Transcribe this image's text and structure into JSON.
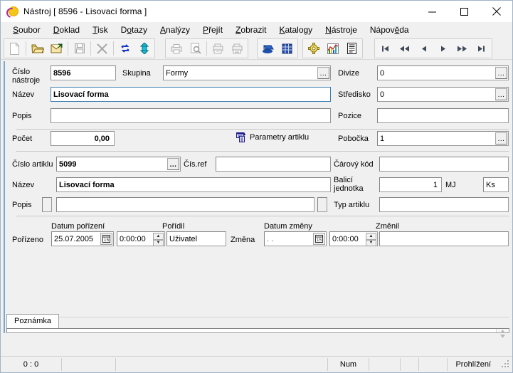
{
  "window": {
    "title": "Nástroj [ 8596 - Lisovací forma ]",
    "icon": "app-logo-icon",
    "minimize": "minimize-icon",
    "maximize": "maximize-icon",
    "close": "close-icon"
  },
  "menu": {
    "items": [
      {
        "label": "Soubor",
        "accel": "S"
      },
      {
        "label": "Doklad",
        "accel": "D"
      },
      {
        "label": "Tisk",
        "accel": "T"
      },
      {
        "label": "Dotazy",
        "accel": "o"
      },
      {
        "label": "Analýzy",
        "accel": "A"
      },
      {
        "label": "Přejít",
        "accel": "P"
      },
      {
        "label": "Zobrazit",
        "accel": "Z"
      },
      {
        "label": "Katalogy",
        "accel": "K"
      },
      {
        "label": "Nástroje",
        "accel": "N"
      },
      {
        "label": "Nápověda",
        "accel": "ě"
      }
    ]
  },
  "toolbar": {
    "groups": [
      {
        "buttons": [
          "new-document-icon",
          "open-folder-icon",
          "save-as-icon",
          "save-disk-icon",
          "delete-cross-icon",
          "refresh-icon",
          "expand-updown-icon"
        ]
      },
      {
        "buttons": [
          "print-icon",
          "print-preview-icon",
          "print-multi-icon",
          "print-batch-icon"
        ]
      },
      {
        "buttons": [
          "archive-box-icon",
          "grid-table-icon"
        ]
      },
      {
        "buttons": [
          "settings-gear-icon",
          "chart-icon",
          "list-report-icon"
        ]
      },
      {
        "buttons": [
          "nav-first-icon",
          "nav-prev-page-icon",
          "nav-prev-icon",
          "nav-next-icon",
          "nav-next-page-icon",
          "nav-last-icon"
        ]
      }
    ]
  },
  "form": {
    "tool_number": {
      "label_line1": "Číslo",
      "label_line2": "nástroje",
      "value": "8596"
    },
    "group": {
      "label": "Skupina",
      "value": "Formy",
      "button": "..."
    },
    "division": {
      "label": "Divize",
      "value": "0",
      "button": "..."
    },
    "name_tool": {
      "label": "Název",
      "value": "Lisovací forma"
    },
    "center": {
      "label": "Středisko",
      "value": "0",
      "button": "..."
    },
    "description_tool": {
      "label": "Popis",
      "value": ""
    },
    "position": {
      "label": "Pozice",
      "value": ""
    },
    "count": {
      "label": "Počet",
      "value": "0,00"
    },
    "parameters_link": {
      "label": "Parametry artiklu",
      "icon": "parameters-icon"
    },
    "branch": {
      "label": "Pobočka",
      "value": "1",
      "button": "..."
    },
    "article_number": {
      "label": "Číslo artiklu",
      "value": "5099",
      "button": "..."
    },
    "ref_number": {
      "label": "Čís.ref",
      "value": ""
    },
    "barcode": {
      "label": "Čárový kód",
      "value": ""
    },
    "article_name": {
      "label": "Název",
      "value": "Lisovací forma"
    },
    "pack_unit": {
      "label_line1": "Balicí",
      "label_line2": "jednotka",
      "value": "1",
      "unit_label": "MJ",
      "unit_value": "Ks"
    },
    "article_description": {
      "label": "Popis",
      "value": ""
    },
    "article_type": {
      "label": "Typ artiklu",
      "value": ""
    },
    "created": {
      "row_label": "Pořízeno",
      "date_label": "Datum pořízení",
      "date_value": "25.07.2005",
      "time_value": "0:00:00",
      "by_label": "Pořídil",
      "by_value": "Uživatel"
    },
    "changed": {
      "row_label": "Změna",
      "date_label": "Datum změny",
      "date_value": ". .",
      "time_value": "0:00:00",
      "by_label": "Změnil",
      "by_value": ""
    }
  },
  "notes": {
    "tab_label": "Poznámka",
    "text": ""
  },
  "statusbar": {
    "record_counter": "0 :   0",
    "cell2": "",
    "cell3": "",
    "num_lock": "Num",
    "cell5": "",
    "cell6": "",
    "cell7": "",
    "mode": "Prohlížení"
  },
  "colors": {
    "window_bg": "#f0f0f0",
    "field_bg": "#ffffff",
    "focus_border": "#3c7fb1",
    "accent_rail": "#7aa6d0",
    "title_bg": "#ffffff"
  }
}
